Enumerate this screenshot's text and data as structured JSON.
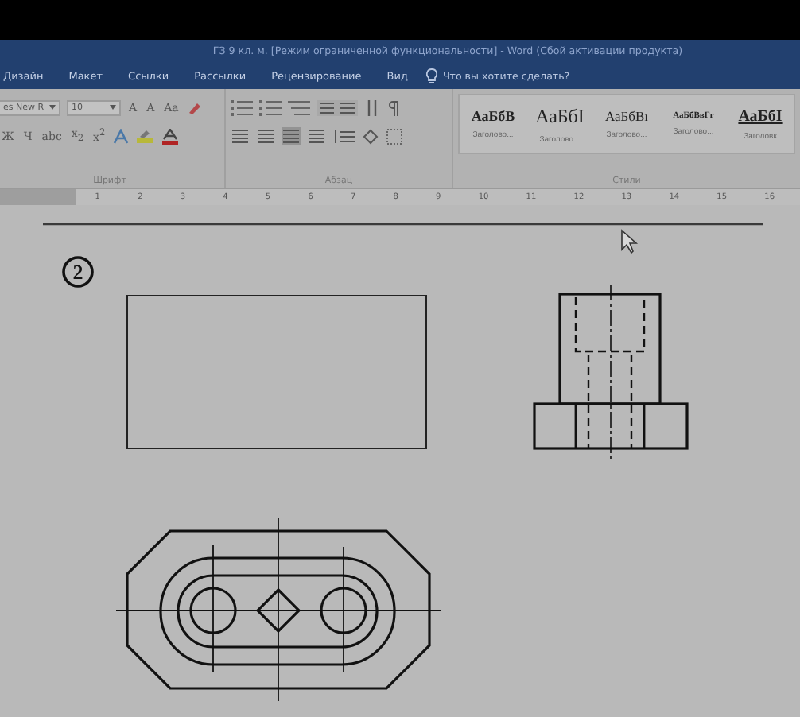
{
  "window": {
    "title": "ГЗ 9 кл. м. [Режим ограниченной функциональности] - Word (Сбой активации продукта)"
  },
  "tabs": [
    {
      "label": "Дизайн",
      "selected": false
    },
    {
      "label": "Макет",
      "selected": false
    },
    {
      "label": "Ссылки",
      "selected": false
    },
    {
      "label": "Рассылки",
      "selected": false
    },
    {
      "label": "Рецензирование",
      "selected": false
    },
    {
      "label": "Вид",
      "selected": false
    }
  ],
  "tell_me": {
    "placeholder": "Что вы хотите сделать?"
  },
  "font": {
    "name": "es New R",
    "size": "10"
  },
  "font_row1": [
    "A",
    "A",
    "Aa"
  ],
  "font_row2": [
    "Ж",
    "Ч",
    "abc",
    "x$_{2}$",
    "x$^{2}$"
  ],
  "groups": [
    "Шрифт",
    "Абзац",
    "Стили"
  ],
  "styles": [
    {
      "sample": "АаБбВ",
      "caption": "Заголово...",
      "kind": "bold"
    },
    {
      "sample": "АаБбІ",
      "caption": "Заголово...",
      "kind": "large"
    },
    {
      "sample": "АаБбВı",
      "caption": "Заголово...",
      "kind": "plain"
    },
    {
      "sample": "АаБбВвГг",
      "caption": "Заголово...",
      "kind": "small"
    },
    {
      "sample": "АаБбІ",
      "caption": "Заголовк",
      "kind": "underlined"
    }
  ],
  "ruler": [
    "1",
    "2",
    "3",
    "4",
    "5",
    "6",
    "7",
    "8",
    "9",
    "10",
    "11",
    "12",
    "13",
    "14",
    "15",
    "16"
  ],
  "document": {
    "task_number": "2"
  }
}
